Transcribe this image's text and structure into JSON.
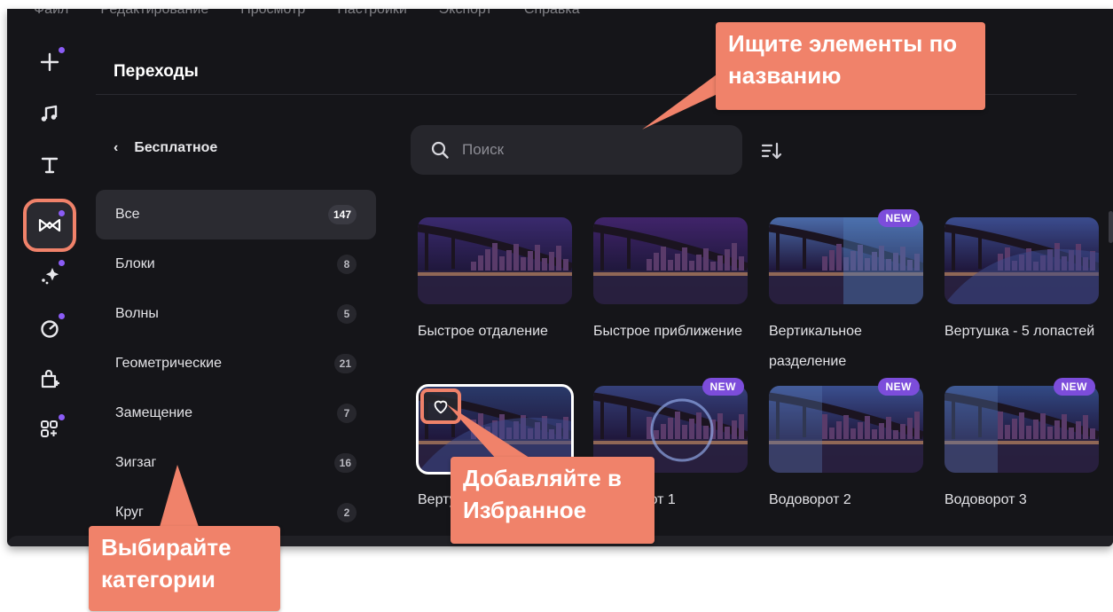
{
  "menu": [
    "Файл",
    "Редактирование",
    "Просмотр",
    "Настройки",
    "Экспорт",
    "Справка"
  ],
  "rail": [
    {
      "icon": "plus-icon",
      "dot": true
    },
    {
      "icon": "music-icon",
      "dot": false
    },
    {
      "icon": "text-icon",
      "dot": false
    },
    {
      "icon": "transitions-icon",
      "dot": true,
      "active": true
    },
    {
      "icon": "effects-icon",
      "dot": true
    },
    {
      "icon": "stickers-icon",
      "dot": true
    },
    {
      "icon": "store-icon",
      "dot": false
    },
    {
      "icon": "more-apps-icon",
      "dot": true
    }
  ],
  "panel": {
    "title": "Переходы"
  },
  "back": {
    "label": "Бесплатное"
  },
  "categories": [
    {
      "label": "Все",
      "count": "147",
      "active": true
    },
    {
      "label": "Блоки",
      "count": "8"
    },
    {
      "label": "Волны",
      "count": "5"
    },
    {
      "label": "Геометрические",
      "count": "21"
    },
    {
      "label": "Замещение",
      "count": "7"
    },
    {
      "label": "Зигзаг",
      "count": "16"
    },
    {
      "label": "Круг",
      "count": "2"
    }
  ],
  "search": {
    "placeholder": "Поиск"
  },
  "tiles": [
    {
      "label": "Быстрое отдаление",
      "new": false
    },
    {
      "label": "Быстрое приближение",
      "new": false
    },
    {
      "label": "Вертикальное разделение",
      "new": true
    },
    {
      "label": "Вертушка - 5 лопастей",
      "new": false
    },
    {
      "label": "Вертушка - 5 лопастей",
      "new": false,
      "selected": true
    },
    {
      "label": "Водоворот 1",
      "new": true
    },
    {
      "label": "Водоворот 2",
      "new": true
    },
    {
      "label": "Водоворот 3",
      "new": true
    }
  ],
  "new_badge": "NEW",
  "callouts": {
    "search": "Ищите элементы по названию",
    "favorites": "Добавляйте в Избранное",
    "categories": "Выбирайте категории"
  },
  "colors": {
    "accent": "#f0826a",
    "badge": "#7c4ddb",
    "background": "#151519"
  }
}
